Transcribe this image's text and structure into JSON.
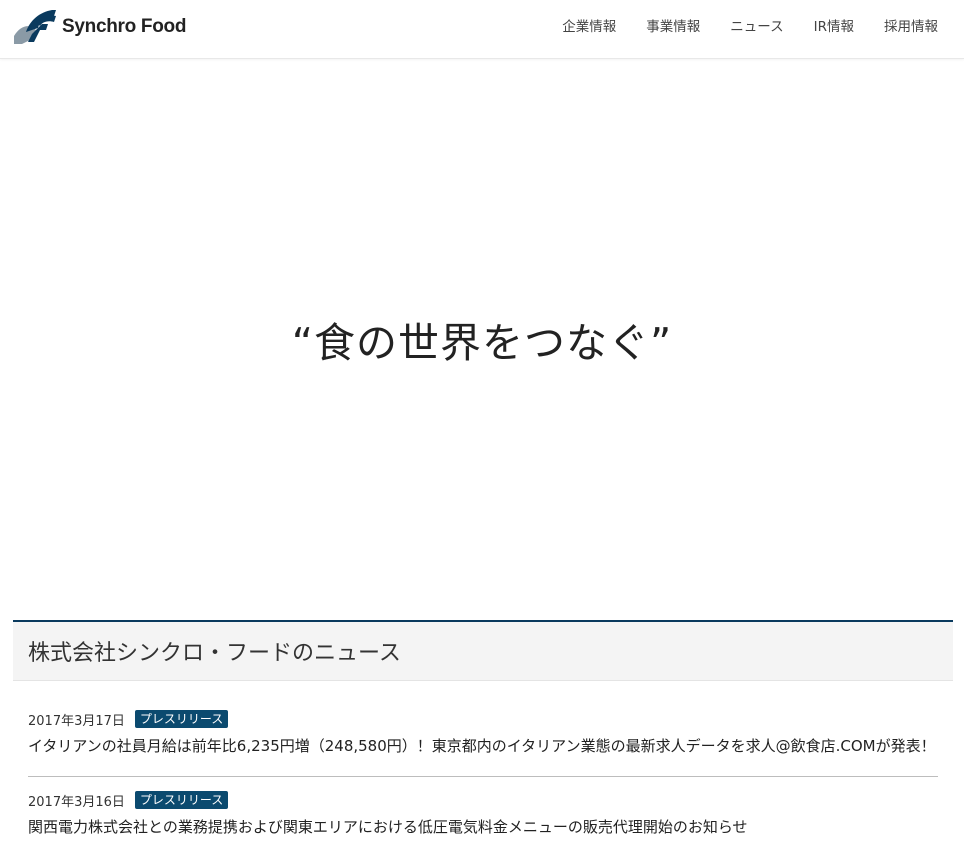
{
  "brand": {
    "name": "Synchro Food",
    "logo_color_primary": "#0a3a5e",
    "logo_color_secondary": "#8a9aa6"
  },
  "nav": {
    "items": [
      {
        "label": "企業情報"
      },
      {
        "label": "事業情報"
      },
      {
        "label": "ニュース"
      },
      {
        "label": "IR情報"
      },
      {
        "label": "採用情報"
      }
    ]
  },
  "hero": {
    "copy": "“食の世界をつなぐ”"
  },
  "news": {
    "title": "株式会社シンクロ・フードのニュース",
    "accent_color": "#0a3a5e",
    "items": [
      {
        "date": "2017年3月17日",
        "category": "プレスリリース",
        "headline": "イタリアンの社員月給は前年比6,235円増（248,580円）！東京都内のイタリアン業態の最新求人データを求人@飲食店.COMが発表！"
      },
      {
        "date": "2017年3月16日",
        "category": "プレスリリース",
        "headline": "関西電力株式会社との業務提携および関東エリアにおける低圧電気料金メニューの販売代理開始のお知らせ"
      }
    ]
  }
}
